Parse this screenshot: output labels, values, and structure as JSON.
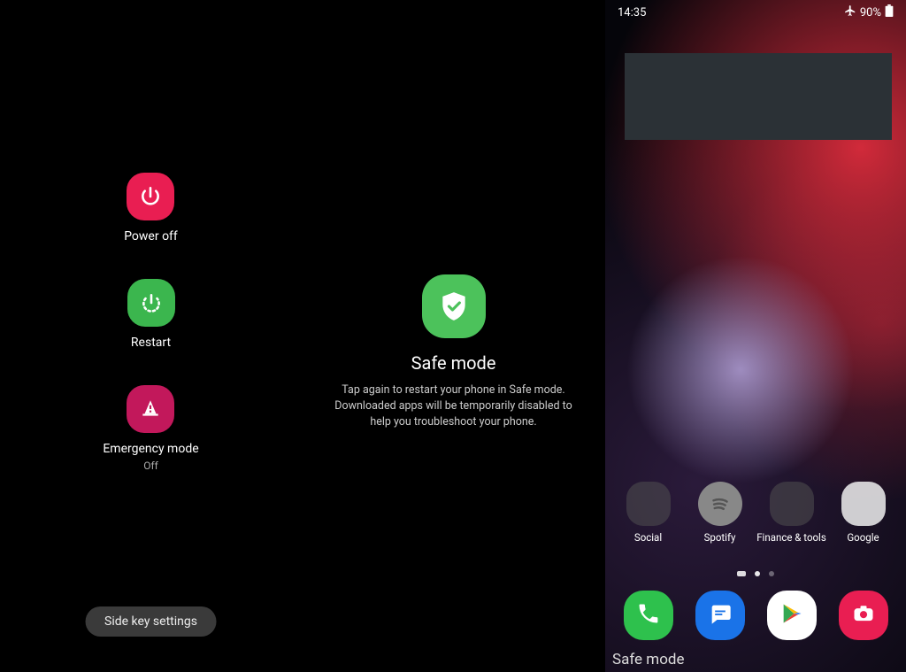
{
  "left": {
    "power_off": "Power off",
    "restart": "Restart",
    "emergency": "Emergency mode",
    "emergency_state": "Off",
    "side_key": "Side key settings"
  },
  "mid": {
    "title": "Safe mode",
    "desc": "Tap again to restart your phone in Safe mode. Downloaded apps will be temporarily disabled to help you troubleshoot your phone."
  },
  "right": {
    "time": "14:35",
    "battery": "90%",
    "apps": [
      {
        "label": "Social"
      },
      {
        "label": "Spotify"
      },
      {
        "label": "Finance & tools"
      },
      {
        "label": "Google"
      }
    ],
    "safe_mode_label": "Safe mode"
  }
}
